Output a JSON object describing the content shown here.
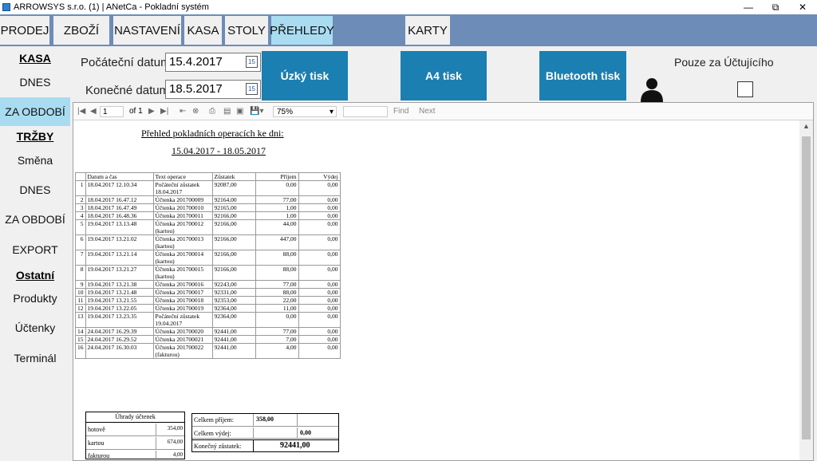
{
  "window": {
    "title": "ARROWSYS s.r.o. (1) | ANetCa - Pokladní systém"
  },
  "menu": {
    "tabs": [
      "PRODEJ",
      "ZBOŽÍ",
      "NASTAVENÍ",
      "KASA",
      "STOLY",
      "PŘEHLEDY",
      "KARTY"
    ],
    "active": "PŘEHLEDY"
  },
  "sidebar": {
    "kasa_header": "KASA",
    "kasa_dnes": "DNES",
    "kasa_za_obdobi": "ZA OBDOBÍ",
    "trzby_header": "TRŽBY",
    "smena": "Směna",
    "trzby_dnes": "DNES",
    "trzby_za_obdobi": "ZA OBDOBÍ",
    "export": "EXPORT",
    "ostatni_header": "Ostatní",
    "produkty": "Produkty",
    "uctenky": "Účtenky",
    "terminal": "Terminál"
  },
  "filters": {
    "start_label": "Počáteční datum",
    "start_value": "15.4.2017",
    "end_label": "Konečné datum",
    "end_value": "18.5.2017",
    "calendar_icon_text": "15"
  },
  "buttons": {
    "narrow_print": "Úzký tisk",
    "a4_print": "A4 tisk",
    "bluetooth_print": "Bluetooth tisk"
  },
  "only_accountant": {
    "label": "Pouze za Účtujícího"
  },
  "report_toolbar": {
    "page": "1",
    "of_pages": "of 1",
    "zoom": "75%",
    "find": "Find",
    "next": "Next"
  },
  "report": {
    "title": "Přehled pokladních operacích ke dni:",
    "period": "15.04.2017 - 18.05.2017",
    "columns": [
      "",
      "Datum a čas",
      "Text operace",
      "Zůstatek",
      "Příjem",
      "Výdej"
    ],
    "rows": [
      [
        "1",
        "18.04.2017 12.10.34",
        "Počáteční zůstatek 18.04.2017",
        "92087,00",
        "0,00",
        "0,00"
      ],
      [
        "2",
        "18.04.2017 16.47.12",
        "Účtenka 201700009",
        "92164,00",
        "77,00",
        "0,00"
      ],
      [
        "3",
        "18.04.2017 16.47.49",
        "Účtenka 201700010",
        "92165,00",
        "1,00",
        "0,00"
      ],
      [
        "4",
        "18.04.2017 16.48.36",
        "Účtenka 201700011",
        "92166,00",
        "1,00",
        "0,00"
      ],
      [
        "5",
        "19.04.2017 13.13.48",
        "Účtenka 201700012 (kartou)",
        "92166,00",
        "44,00",
        "0,00"
      ],
      [
        "6",
        "19.04.2017 13.21.02",
        "Účtenka 201700013 (kartou)",
        "92166,00",
        "447,00",
        "0,00"
      ],
      [
        "7",
        "19.04.2017 13.21.14",
        "Účtenka 201700014 (kartou)",
        "92166,00",
        "88,00",
        "0,00"
      ],
      [
        "8",
        "19.04.2017 13.21.27",
        "Účtenka 201700015 (kartou)",
        "92166,00",
        "88,00",
        "0,00"
      ],
      [
        "9",
        "19.04.2017 13.21.38",
        "Účtenka 201700016",
        "92243,00",
        "77,00",
        "0,00"
      ],
      [
        "10",
        "19.04.2017 13.21.48",
        "Účtenka 201700017",
        "92331,00",
        "88,00",
        "0,00"
      ],
      [
        "11",
        "19.04.2017 13.21.55",
        "Účtenka 201700018",
        "92353,00",
        "22,00",
        "0,00"
      ],
      [
        "12",
        "19.04.2017 13.22.05",
        "Účtenka 201700019",
        "92364,00",
        "11,00",
        "0,00"
      ],
      [
        "13",
        "19.04.2017 13.23.35",
        "Počáteční zůstatek 19.04.2017",
        "92364,00",
        "0,00",
        "0,00"
      ],
      [
        "14",
        "24.04.2017 16.29.39",
        "Účtenka 201700020",
        "92441,00",
        "77,00",
        "0,00"
      ],
      [
        "15",
        "24.04.2017 16.29.52",
        "Účtenka 201700021",
        "92441,00",
        "7,00",
        "0,00"
      ],
      [
        "16",
        "24.04.2017 16.30.03",
        "Účtenka 201700022 (fakturou)",
        "92441,00",
        "4,00",
        "0,00"
      ]
    ],
    "payments": {
      "header": "Úhrady účtenek",
      "rows": [
        [
          "hotově",
          "354,00"
        ],
        [
          "kartou",
          "674,00"
        ],
        [
          "fakturou",
          "4,00"
        ]
      ]
    },
    "totals": {
      "income_label": "Celkem příjem:",
      "income_value": "358,00",
      "expense_label": "Celkem výdej:",
      "expense_value": "0,00",
      "final_label": "Konečný zůstatek:",
      "final_value": "92441,00"
    }
  },
  "colors": {
    "menubar": "#6d8cb8",
    "active_tab": "#a9dcf1",
    "button_blue": "#1b7fb1"
  }
}
